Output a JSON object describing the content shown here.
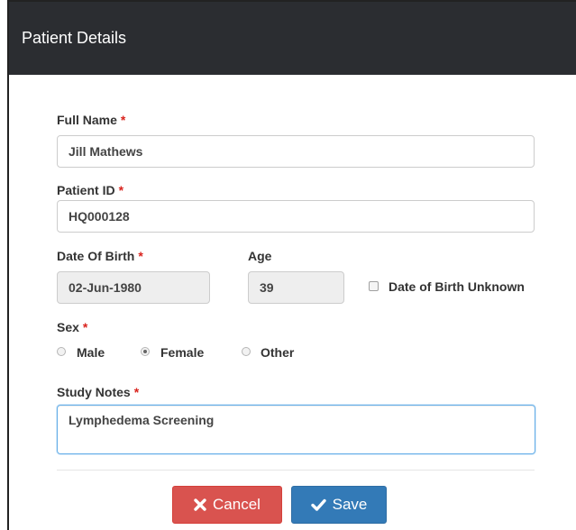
{
  "header": {
    "title": "Patient Details"
  },
  "form": {
    "required_mark": "*",
    "full_name": {
      "label": "Full Name",
      "value": "Jill Mathews"
    },
    "patient_id": {
      "label": "Patient ID",
      "value": "HQ000128"
    },
    "dob": {
      "label": "Date Of Birth",
      "value": "02-Jun-1980"
    },
    "age": {
      "label": "Age",
      "value": "39"
    },
    "dob_unknown": {
      "label": "Date of Birth Unknown",
      "checked": false
    },
    "sex": {
      "label": "Sex",
      "options": [
        "Male",
        "Female",
        "Other"
      ],
      "selected": "Female"
    },
    "study_notes": {
      "label": "Study Notes",
      "value": "Lymphedema Screening"
    }
  },
  "actions": {
    "cancel_label": "Cancel",
    "save_label": "Save",
    "cancel_icon": "x-icon",
    "save_icon": "check-icon"
  },
  "colors": {
    "header_bg": "#2b2d31",
    "required": "#d9231d",
    "cancel_bg": "#d9534f",
    "save_bg": "#337ab7",
    "focus_border": "#66afe9"
  }
}
